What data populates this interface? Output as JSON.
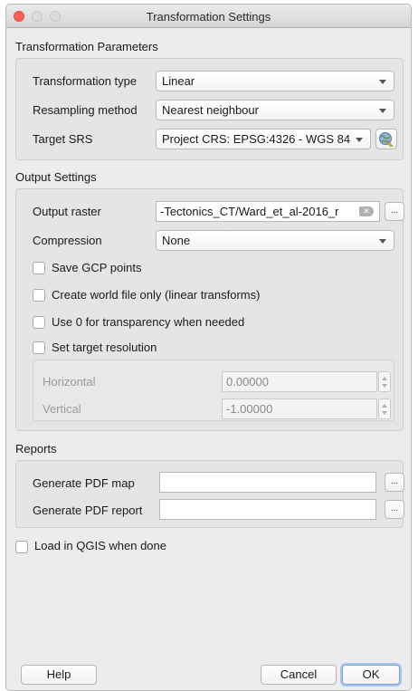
{
  "window": {
    "title": "Transformation Settings"
  },
  "transformation_parameters": {
    "title": "Transformation Parameters",
    "type_label": "Transformation type",
    "type_value": "Linear",
    "resampling_label": "Resampling method",
    "resampling_value": "Nearest neighbour",
    "srs_label": "Target SRS",
    "srs_value": "Project CRS: EPSG:4326 - WGS 84"
  },
  "output_settings": {
    "title": "Output Settings",
    "output_raster_label": "Output raster",
    "output_raster_value": "-Tectonics_CT/Ward_et_al-2016_r",
    "browse_label": "...",
    "compression_label": "Compression",
    "compression_value": "None",
    "save_gcp_label": "Save GCP points",
    "world_file_label": "Create world file only (linear transforms)",
    "transparency_label": "Use 0 for transparency when needed",
    "target_resolution_label": "Set target resolution",
    "horizontal_label": "Horizontal",
    "horizontal_value": "0.00000",
    "vertical_label": "Vertical",
    "vertical_value": "-1.00000"
  },
  "reports": {
    "title": "Reports",
    "pdf_map_label": "Generate PDF map",
    "pdf_map_value": "",
    "pdf_report_label": "Generate PDF report",
    "pdf_report_value": "",
    "browse_label": "..."
  },
  "load_in_qgis_label": "Load in QGIS when done",
  "buttons": {
    "help": "Help",
    "cancel": "Cancel",
    "ok": "OK"
  },
  "colors": {
    "close": "#fc5f57",
    "dialog_bg": "#ececec",
    "ok_focus": "#a6c6ee"
  },
  "icons": {
    "crs_selector": "globe-icon",
    "clear": "clear-text-icon"
  }
}
